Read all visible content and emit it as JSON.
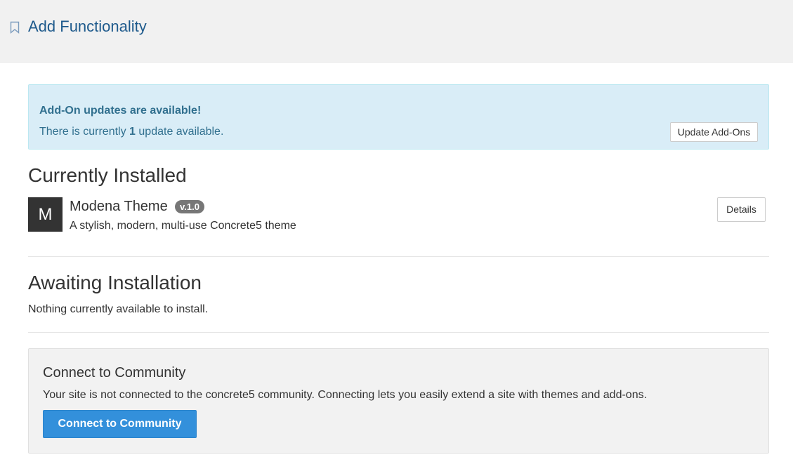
{
  "header": {
    "title": "Add Functionality",
    "icon": "bookmark-icon"
  },
  "alert": {
    "title": "Add-On updates are available!",
    "text_prefix": "There is currently ",
    "count": "1",
    "text_suffix": " update available.",
    "button_label": "Update Add-Ons"
  },
  "installed": {
    "heading": "Currently Installed",
    "packages": [
      {
        "icon_letter": "M",
        "name": "Modena Theme",
        "version": "v.1.0",
        "description": "A stylish, modern, multi-use Concrete5 theme",
        "details_label": "Details"
      }
    ]
  },
  "awaiting": {
    "heading": "Awaiting Installation",
    "empty_text": "Nothing currently available to install."
  },
  "community": {
    "title": "Connect to Community",
    "text": "Your site is not connected to the concrete5 community. Connecting lets you easily extend a site with themes and add-ons.",
    "button_label": "Connect to Community"
  },
  "colors": {
    "title_link": "#1e5a8c",
    "alert_bg": "#d9edf7",
    "alert_text": "#31708f",
    "primary_button": "#3390db",
    "badge": "#777777"
  }
}
